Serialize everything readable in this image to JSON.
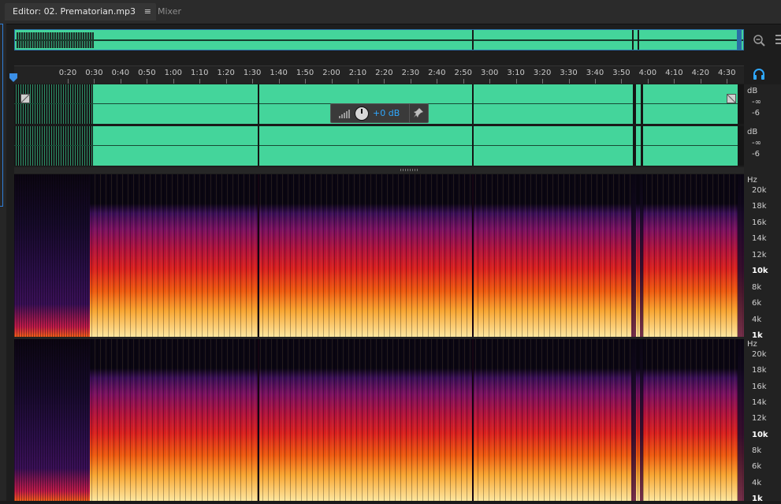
{
  "tabs": {
    "editor_label": "Editor: 02. Prematorian.mp3",
    "editor_menu_glyph": "≡",
    "mixer_label": "Mixer"
  },
  "icons": {
    "zoom": "zoom-out-icon",
    "edge_menu": "panel-menu-icon",
    "monitor": "headphones-icon",
    "playhead": "playhead-icon",
    "hud_meter": "volume-bars-icon",
    "hud_knob": "volume-knob-icon",
    "hud_pin": "pin-icon"
  },
  "ruler": {
    "unit_label": "hms",
    "ticks": [
      "0:20",
      "0:30",
      "0:40",
      "0:50",
      "1:00",
      "1:10",
      "1:20",
      "1:30",
      "1:40",
      "1:50",
      "2:00",
      "2:10",
      "2:20",
      "2:30",
      "2:40",
      "2:50",
      "3:00",
      "3:10",
      "3:20",
      "3:30",
      "3:40",
      "3:50",
      "4:00",
      "4:10",
      "4:20",
      "4:30"
    ]
  },
  "hud": {
    "volume_value": "+0 dB"
  },
  "db_scale_left": [
    "dB",
    "-∞",
    "-6"
  ],
  "db_scale_right": [
    "dB",
    "-∞",
    "-6"
  ],
  "hz_scale_left": {
    "unit": "Hz",
    "labels": [
      "20k",
      "18k",
      "16k",
      "14k",
      "12k",
      "10k",
      "8k",
      "6k",
      "4k",
      "1k"
    ]
  },
  "hz_scale_right": {
    "unit": "Hz",
    "labels": [
      "20k",
      "18k",
      "16k",
      "14k",
      "12k",
      "10k",
      "8k",
      "6k",
      "4k",
      "1k"
    ]
  },
  "colors": {
    "waveform": "#44d59b",
    "accent": "#2fa8ff",
    "spectral_hot": "#fde7a0",
    "spectral_mid": "#d81f1f",
    "spectral_cold": "#3a0f57"
  }
}
